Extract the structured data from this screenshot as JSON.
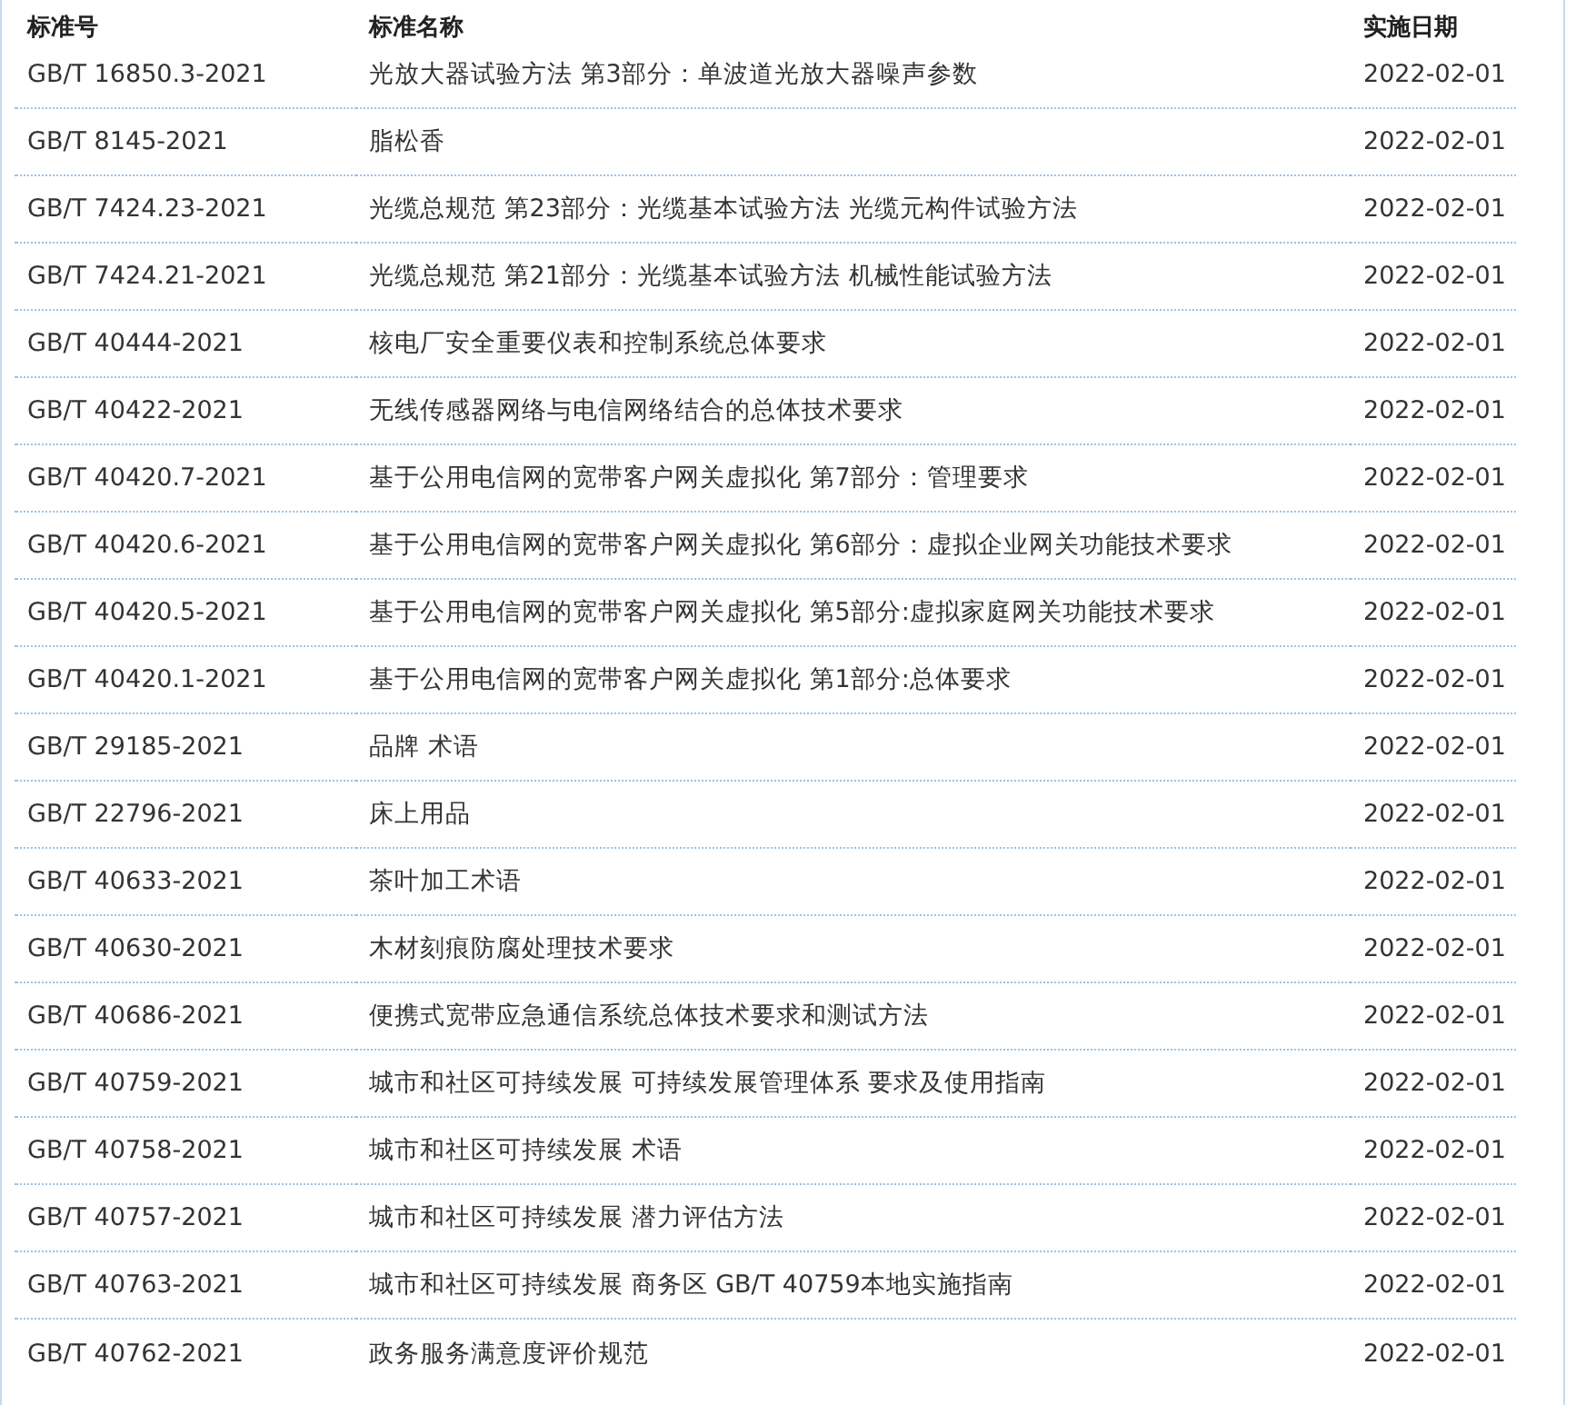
{
  "table": {
    "columns": [
      "标准号",
      "标准名称",
      "实施日期"
    ],
    "rows": [
      [
        "GB/T 16850.3-2021",
        "光放大器试验方法 第3部分：单波道光放大器噪声参数",
        "2022-02-01"
      ],
      [
        "GB/T 8145-2021",
        "脂松香",
        "2022-02-01"
      ],
      [
        "GB/T 7424.23-2021",
        "光缆总规范 第23部分：光缆基本试验方法 光缆元构件试验方法",
        "2022-02-01"
      ],
      [
        "GB/T 7424.21-2021",
        "光缆总规范 第21部分：光缆基本试验方法 机械性能试验方法",
        "2022-02-01"
      ],
      [
        "GB/T 40444-2021",
        "核电厂安全重要仪表和控制系统总体要求",
        "2022-02-01"
      ],
      [
        "GB/T 40422-2021",
        "无线传感器网络与电信网络结合的总体技术要求",
        "2022-02-01"
      ],
      [
        "GB/T 40420.7-2021",
        "基于公用电信网的宽带客户网关虚拟化 第7部分：管理要求",
        "2022-02-01"
      ],
      [
        "GB/T 40420.6-2021",
        "基于公用电信网的宽带客户网关虚拟化 第6部分：虚拟企业网关功能技术要求",
        "2022-02-01"
      ],
      [
        "GB/T 40420.5-2021",
        "基于公用电信网的宽带客户网关虚拟化 第5部分:虚拟家庭网关功能技术要求",
        "2022-02-01"
      ],
      [
        "GB/T 40420.1-2021",
        "基于公用电信网的宽带客户网关虚拟化 第1部分:总体要求",
        "2022-02-01"
      ],
      [
        "GB/T 29185-2021",
        "品牌 术语",
        "2022-02-01"
      ],
      [
        "GB/T 22796-2021",
        "床上用品",
        "2022-02-01"
      ],
      [
        "GB/T 40633-2021",
        "茶叶加工术语",
        "2022-02-01"
      ],
      [
        "GB/T 40630-2021",
        "木材刻痕防腐处理技术要求",
        "2022-02-01"
      ],
      [
        "GB/T 40686-2021",
        "便携式宽带应急通信系统总体技术要求和测试方法",
        "2022-02-01"
      ],
      [
        "GB/T 40759-2021",
        "城市和社区可持续发展 可持续发展管理体系 要求及使用指南",
        "2022-02-01"
      ],
      [
        "GB/T 40758-2021",
        "城市和社区可持续发展 术语",
        "2022-02-01"
      ],
      [
        "GB/T 40757-2021",
        "城市和社区可持续发展 潜力评估方法",
        "2022-02-01"
      ],
      [
        "GB/T 40763-2021",
        "城市和社区可持续发展 商务区 GB/T 40759本地实施指南",
        "2022-02-01"
      ],
      [
        "GB/T 40762-2021",
        "政务服务满意度评价规范",
        "2022-02-01"
      ]
    ]
  }
}
